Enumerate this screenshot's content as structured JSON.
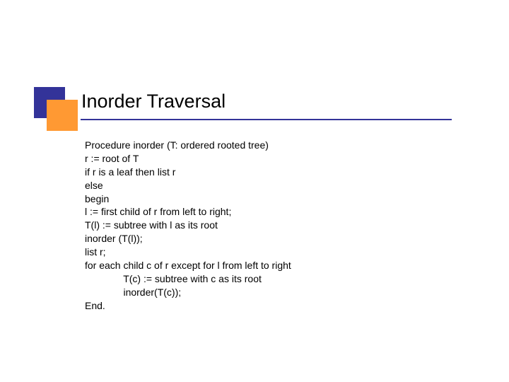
{
  "slide": {
    "title": "Inorder Traversal",
    "lines": [
      "Procedure inorder (T: ordered rooted tree)",
      "r := root of T",
      "if r is a leaf then list r",
      "else",
      "begin",
      "l := first child of r from left to right;",
      "T(l) := subtree with l as its root",
      "inorder (T(l));",
      "list r;",
      "for each child c of r except for l from left to right",
      "              T(c) := subtree with c as its root",
      "              inorder(T(c));",
      "End."
    ]
  }
}
